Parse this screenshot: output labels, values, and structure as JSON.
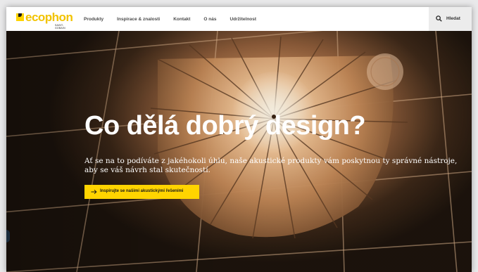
{
  "header": {
    "logo_text": "ecophon",
    "logo_sub": "SAINT-GOBAIN",
    "nav": [
      "Produkty",
      "Inspirace & znalosti",
      "Kontakt",
      "O nás",
      "Udržitelnost"
    ],
    "search_label": "Hledat"
  },
  "hero": {
    "title": "Co dělá dobrý design?",
    "subtitle": "Ať se na to podíváte z jakéhokoli úhlu, naše akustické produkty vám poskytnou ty správné nástroje, aby se váš návrh stal skutečností.",
    "cta_label": "Inspirujte se našimi akustickými řešeními"
  },
  "colors": {
    "brand_yellow": "#ffd400",
    "logo_text": "#f2c300",
    "search_bg": "#ececec"
  },
  "icons": {
    "search": "search-icon",
    "cta_arrow": "arrow-right-icon"
  }
}
